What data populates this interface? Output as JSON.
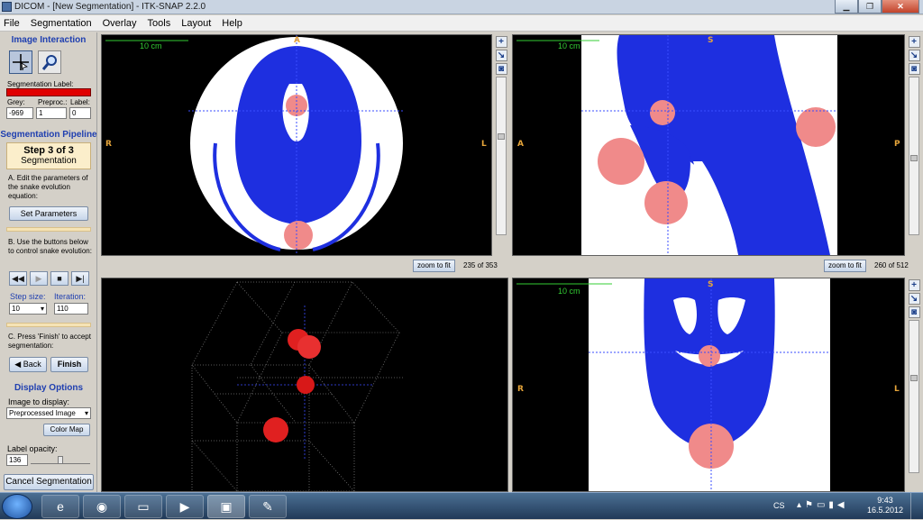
{
  "window": {
    "title": "DICOM - [New Segmentation] - ITK-SNAP 2.2.0"
  },
  "menu": [
    "File",
    "Segmentation",
    "Overlay",
    "Tools",
    "Layout",
    "Help"
  ],
  "left": {
    "image_interaction": "Image Interaction",
    "seg_label_caption": "Segmentation Label:",
    "label_color": "#e00000",
    "grey_caption": "Grey:",
    "preproc_caption": "Preproc.:",
    "label_caption": "Label:",
    "grey_value": "-969",
    "preproc_value": "1",
    "label_value": "0",
    "pipeline_title": "Segmentation Pipeline",
    "step_title": "Step 3 of 3",
    "step_sub": "Segmentation",
    "instr_a": "A. Edit the parameters of the snake evolution equation:",
    "set_params": "Set Parameters",
    "instr_b": "B. Use the buttons below to control snake evolution:",
    "step_size_caption": "Step size:",
    "iteration_caption": "Iteration:",
    "step_size_value": "10",
    "iteration_value": "110",
    "instr_c": "C. Press 'Finish' to accept segmentation:",
    "back": "Back",
    "finish": "Finish",
    "display_options": "Display Options",
    "image_to_display": "Image to display:",
    "image_select": "Preprocessed Image",
    "color_map": "Color Map",
    "label_opacity": "Label opacity:",
    "opacity_value": "136",
    "cancel": "Cancel Segmentation"
  },
  "views": {
    "axial": {
      "scale": "10 cm",
      "top": "A",
      "left": "R",
      "right": "L",
      "zoom": "zoom to fit",
      "slice": "235 of 353"
    },
    "sagittal": {
      "scale": "10 cm",
      "top": "S",
      "left": "A",
      "right": "P",
      "zoom": "zoom to fit",
      "slice": "260 of 512"
    },
    "coronal": {
      "scale": "10 cm",
      "top": "S",
      "left": "R",
      "right": "L"
    }
  },
  "taskbar": {
    "lang": "CS",
    "time": "9:43",
    "date": "16.5.2012"
  }
}
